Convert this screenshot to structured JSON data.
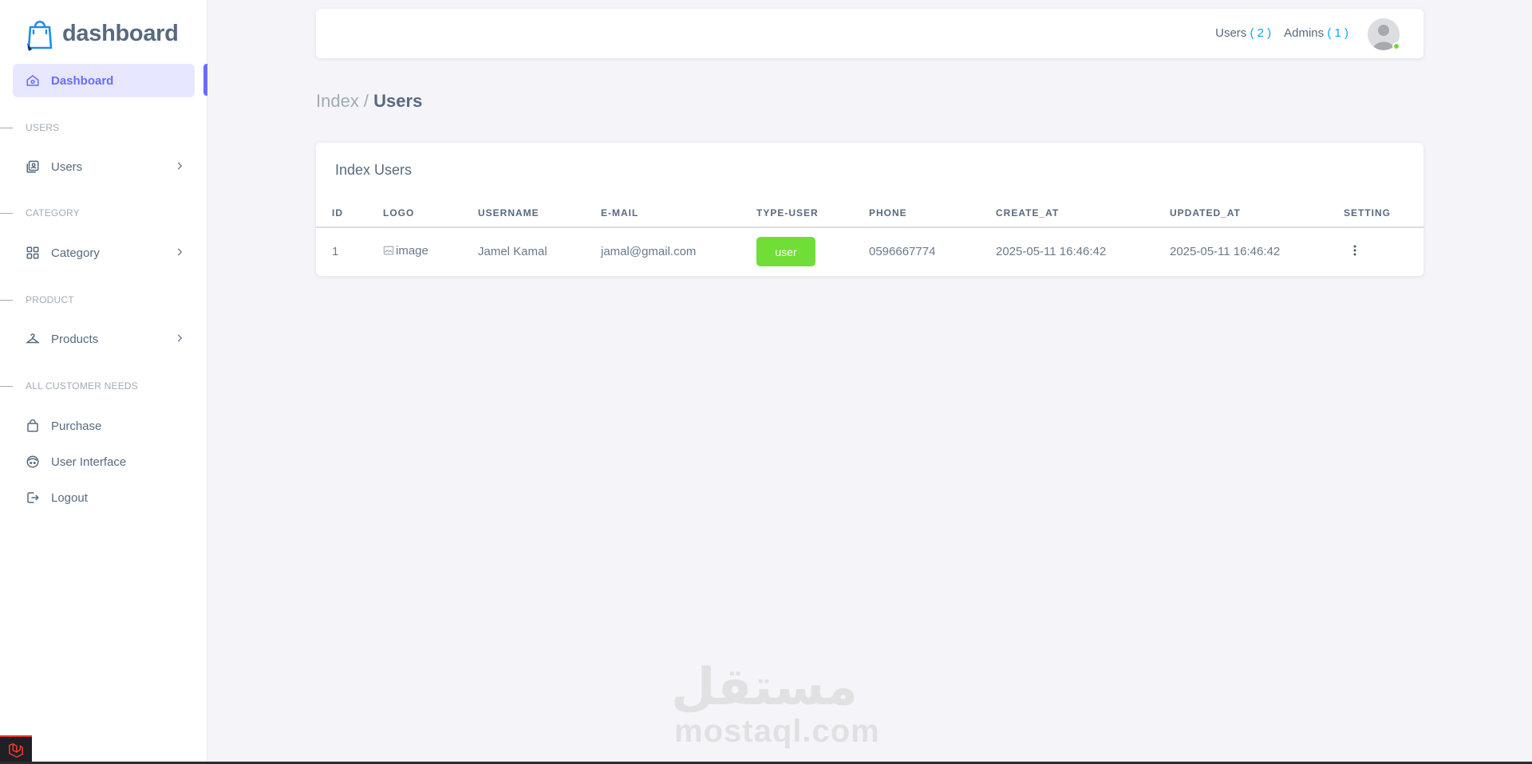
{
  "brand": {
    "name": "dashboard",
    "logo_icon": "shopping-bag-logo-icon"
  },
  "sidebar": {
    "items": [
      {
        "label": "Dashboard",
        "icon": "home-icon",
        "active": true
      },
      {
        "header": "USERS"
      },
      {
        "label": "Users",
        "icon": "user-card-icon",
        "has_submenu": true
      },
      {
        "header": "CATEGORY"
      },
      {
        "label": "Category",
        "icon": "grid-icon",
        "has_submenu": true
      },
      {
        "header": "PRODUCT"
      },
      {
        "label": "Products",
        "icon": "hanger-icon",
        "has_submenu": true
      },
      {
        "header": "ALL CUSTOMER NEEDS"
      },
      {
        "label": "Purchase",
        "icon": "shopping-bag-icon"
      },
      {
        "label": "User Interface",
        "icon": "face-icon"
      },
      {
        "label": "Logout",
        "icon": "logout-icon"
      }
    ]
  },
  "navbar": {
    "users_label": "Users",
    "users_count": "( 2 )",
    "admins_label": "Admins",
    "admins_count": "( 1 )",
    "avatar_icon": "user-avatar-icon",
    "status": "online"
  },
  "breadcrumb": {
    "parent": "Index /",
    "current": "Users"
  },
  "card": {
    "title": "Index Users",
    "columns": [
      "ID",
      "LOGO",
      "USERNAME",
      "E-MAIL",
      "TYPE-USER",
      "PHONE",
      "CREATE_AT",
      "UPDATED_AT",
      "SETTING"
    ],
    "rows": [
      {
        "id": "1",
        "logo_alt": "image",
        "username": "Jamel Kamal",
        "email": "jamal@gmail.com",
        "type": "user",
        "phone": "0596667774",
        "created_at": "2025-05-11 16:46:42",
        "updated_at": "2025-05-11 16:46:42",
        "setting_icon": "kebab-menu-icon"
      }
    ]
  },
  "watermark": {
    "arabic": "مستقل",
    "latin": "mostaql.com"
  },
  "colors": {
    "primary": "#696cff",
    "active_bg": "#e7e7ff",
    "badge_user": "#71dd37",
    "count_accent": "#03a9f4",
    "text": "#566a7f",
    "muted": "#a1acb8",
    "page_bg": "#f5f5f9"
  }
}
